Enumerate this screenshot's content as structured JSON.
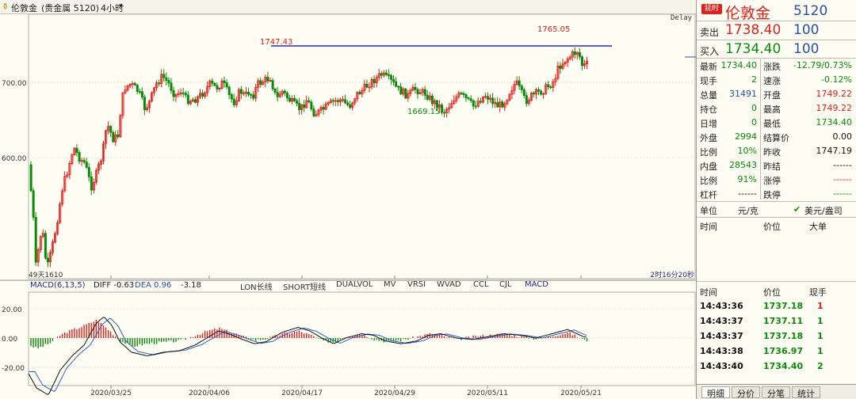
{
  "titlebar": {
    "symbol": "伦敦金",
    "market": "(贵金属 5120)",
    "period": "4小时",
    "delay": "Delay"
  },
  "colors": {
    "up": "#e0201c",
    "down": "#0a8a0a",
    "line": "#0000c8",
    "bg": "#fdfdf3"
  },
  "chart": {
    "annotations": {
      "high1": "1747.43",
      "high2": "1765.05",
      "low1": "1669.15",
      "low0": "1610",
      "low0_prefix": "49天",
      "time_left": "2时16分20秒"
    },
    "price_ticks": [
      "700.00",
      "600.00"
    ],
    "date_ticks": [
      "2020/03/25",
      "2020/04/06",
      "2020/04/17",
      "2020/04/29",
      "2020/05/11",
      "2020/05/21"
    ],
    "indicator_tabs": [
      "LON长线",
      "SHORT短线",
      "DUALVOL",
      "MV",
      "VRSI",
      "WVAD",
      "CCL",
      "CJL",
      "MACD"
    ],
    "macd": {
      "name": "MACD(6,13,5)",
      "diff_label": "DIFF -0.63",
      "dea_label": "DEA 0.96",
      "macd_value": "-3.18",
      "ticks": [
        "20.00",
        "0.00",
        "-20.00"
      ]
    }
  },
  "panel": {
    "badge": "延时",
    "name": "伦敦金",
    "code": "5120",
    "sell_label": "卖出",
    "sell_price": "1738.40",
    "sell_vol": "100",
    "buy_label": "买入",
    "buy_price": "1734.40",
    "buy_vol": "100",
    "stats": [
      {
        "l1": "最新",
        "v1": "1734.40",
        "c1": "green",
        "l2": "涨跌",
        "v2": "-12.79/0.73%",
        "c2": "green"
      },
      {
        "l1": "现手",
        "v1": "2",
        "c1": "green",
        "l2": "速涨",
        "v2": "-0.12%",
        "c2": "green"
      },
      {
        "l1": "总量",
        "v1": "31491",
        "c1": "blue",
        "l2": "开盘",
        "v2": "1749.22",
        "c2": "red"
      },
      {
        "l1": "持仓",
        "v1": "0",
        "c1": "green",
        "l2": "最高",
        "v2": "1749.22",
        "c2": "red"
      },
      {
        "l1": "日增",
        "v1": "0",
        "c1": "green",
        "l2": "最低",
        "v2": "1734.40",
        "c2": "green"
      },
      {
        "l1": "外盘",
        "v1": "2994",
        "c1": "green",
        "l2": "结算价",
        "v2": "0.00",
        "c2": "dark"
      },
      {
        "l1": "比例",
        "v1": "10%",
        "c1": "green",
        "l2": "昨收",
        "v2": "1747.19",
        "c2": "dark"
      },
      {
        "l1": "内盘",
        "v1": "28543",
        "c1": "green",
        "l2": "昨结",
        "v2": "------",
        "c2": "dark"
      },
      {
        "l1": "比例",
        "v1": "91%",
        "c1": "green",
        "l2": "涨停",
        "v2": "------",
        "c2": "red"
      },
      {
        "l1": "杠杆",
        "v1": "------",
        "c1": "dark",
        "l2": "跌停",
        "v2": "------",
        "c2": "green"
      }
    ],
    "unit_label": "单位",
    "unit_value": "元/克",
    "unit_alt": "美元/盎司",
    "list_head": {
      "time": "时间",
      "price": "价位",
      "volume": "大单"
    },
    "trade_head": {
      "time": "时间",
      "price": "价位",
      "volume": "现手"
    },
    "trades": [
      {
        "time": "14:43:36",
        "price": "1737.18",
        "vol": "1",
        "color": "red"
      },
      {
        "time": "14:43:37",
        "price": "1737.11",
        "vol": "1",
        "color": "green"
      },
      {
        "time": "14:43:37",
        "price": "1737.18",
        "vol": "1",
        "color": "green"
      },
      {
        "time": "14:43:38",
        "price": "1736.97",
        "vol": "1",
        "color": "green"
      },
      {
        "time": "14:43:40",
        "price": "1734.40",
        "vol": "2",
        "color": "green"
      }
    ],
    "tabs": [
      "明细",
      "分价",
      "分笔",
      "统计"
    ]
  }
}
